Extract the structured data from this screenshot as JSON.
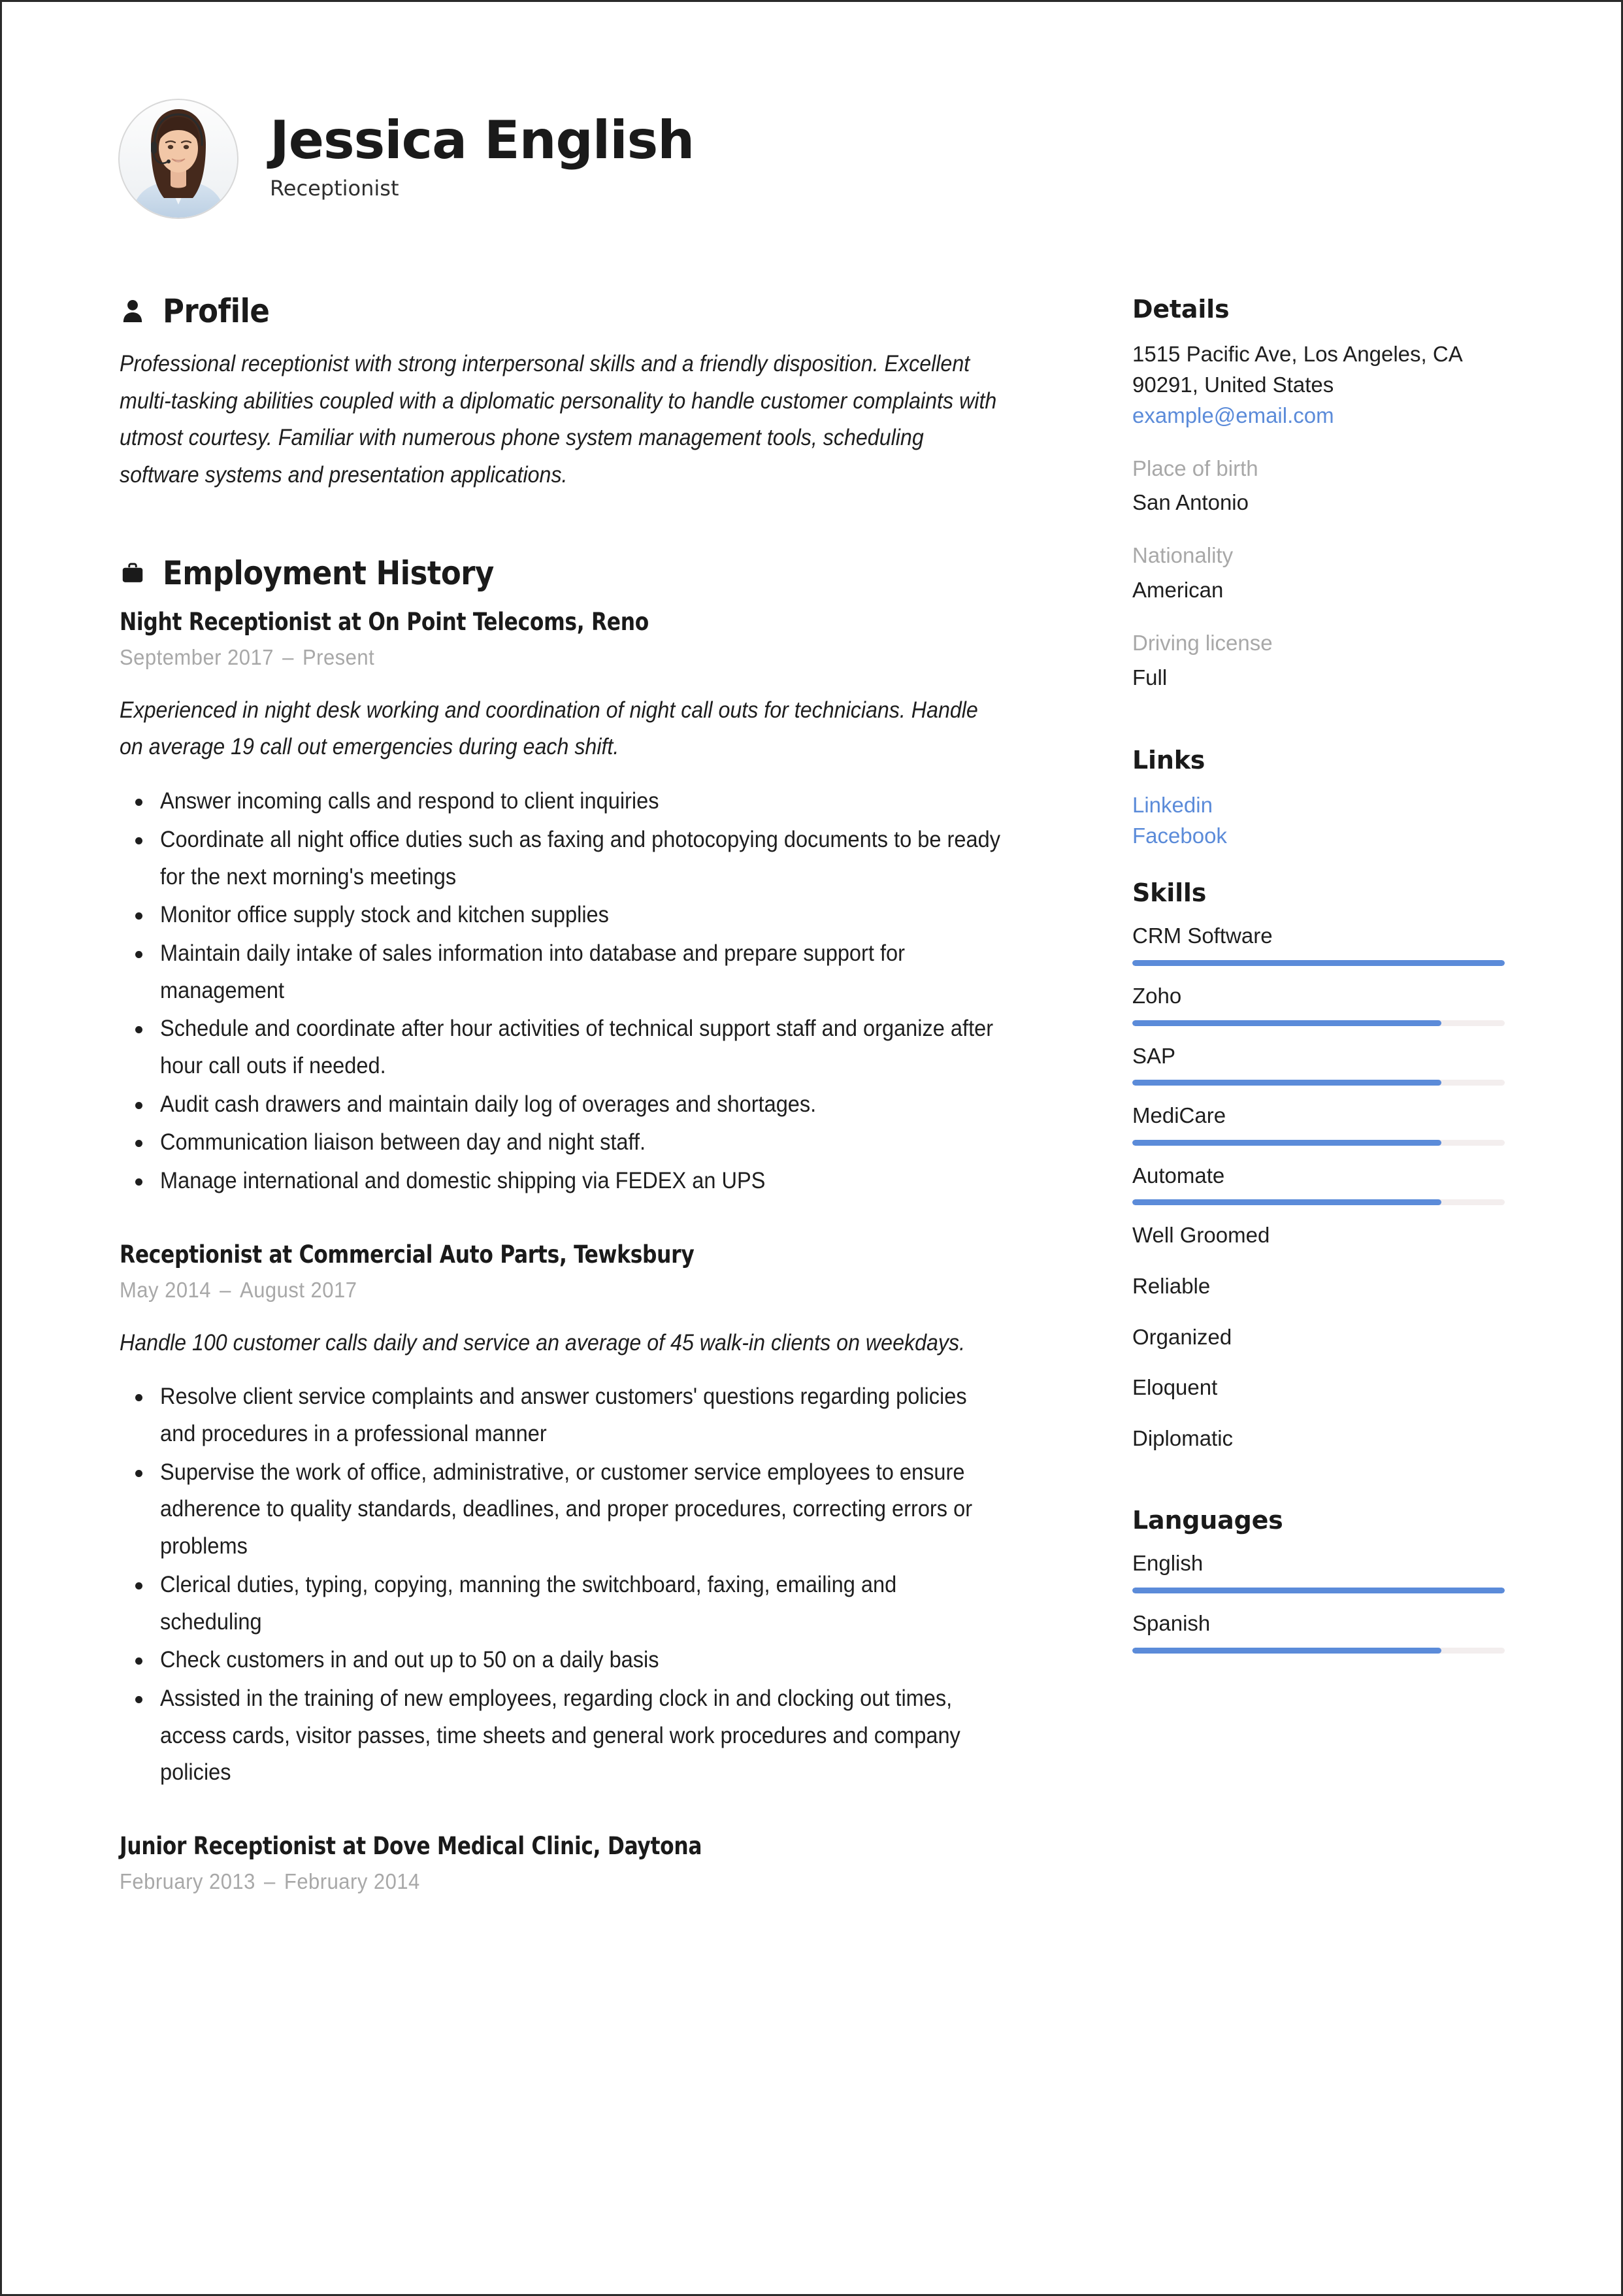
{
  "colors": {
    "accent": "#5b8bd9",
    "text": "#1e1e1e",
    "muted": "#a8a8a8",
    "bar_track": "#f3eeee",
    "heading": "#1a1a1a"
  },
  "header": {
    "full_name": "Jessica English",
    "job_title": "Receptionist",
    "avatar_icon": "person-photo"
  },
  "profile": {
    "icon": "person-icon",
    "title": "Profile",
    "text": "Professional receptionist with strong interpersonal skills and a friendly disposition. Excellent multi-tasking abilities coupled with a diplomatic personality to handle customer complaints with utmost courtesy. Familiar with numerous phone system management tools, scheduling software systems and presentation applications."
  },
  "employment": {
    "icon": "briefcase-icon",
    "title": "Employment History",
    "jobs": [
      {
        "heading": "Night Receptionist at On Point Telecoms, Reno",
        "date_start": "September 2017",
        "date_end": "Present",
        "summary": "Experienced in night desk working and coordination of night call outs for technicians. Handle on average 19 call out emergencies during each shift.",
        "bullets": [
          "Answer incoming calls and respond to client inquiries",
          "Coordinate all night office duties such as faxing and photocopying documents to be ready for the next morning's meetings",
          "Monitor office supply stock and kitchen supplies",
          "Maintain daily intake of sales information into database and prepare support for management",
          "Schedule and coordinate after hour activities of technical support staff and organize after hour call outs if needed.",
          "Audit cash drawers and maintain daily log of overages and shortages.",
          "Communication liaison between day and night staff.",
          "Manage international and domestic shipping via FEDEX an UPS"
        ]
      },
      {
        "heading": "Receptionist at Commercial Auto Parts, Tewksbury",
        "date_start": "May 2014",
        "date_end": "August 2017",
        "summary": "Handle 100 customer calls daily and service an average of 45 walk-in clients on weekdays.",
        "bullets": [
          "Resolve client service complaints and answer customers' questions regarding policies and procedures in a professional manner",
          "Supervise the work of office, administrative, or customer service employees to ensure adherence to quality standards, deadlines, and proper procedures, correcting errors or problems",
          "Clerical duties, typing, copying, manning the switchboard, faxing, emailing and scheduling",
          "Check customers in and out up to 50 on a daily basis",
          "Assisted in the training of new employees, regarding clock in and clocking out times, access cards, visitor passes, time sheets and general work procedures and company policies"
        ]
      },
      {
        "heading": "Junior Receptionist at Dove Medical Clinic, Daytona",
        "date_start": "February 2013",
        "date_end": "February 2014",
        "summary": "",
        "bullets": []
      }
    ],
    "date_separator": "–"
  },
  "details": {
    "title": "Details",
    "address_line_1": "1515 Pacific Ave, Los Angeles, CA",
    "address_line_2": "90291, United States",
    "email": "example@email.com",
    "fields": [
      {
        "label": "Place of birth",
        "value": "San Antonio"
      },
      {
        "label": "Nationality",
        "value": "American"
      },
      {
        "label": "Driving license",
        "value": "Full"
      }
    ]
  },
  "links": {
    "title": "Links",
    "items": [
      {
        "label": "Linkedin"
      },
      {
        "label": "Facebook"
      }
    ]
  },
  "skills": {
    "title": "Skills",
    "items": [
      {
        "label": "CRM Software",
        "level": 100,
        "has_bar": true
      },
      {
        "label": "Zoho",
        "level": 83,
        "has_bar": true
      },
      {
        "label": "SAP",
        "level": 83,
        "has_bar": true
      },
      {
        "label": "MediCare",
        "level": 83,
        "has_bar": true
      },
      {
        "label": "Automate",
        "level": 83,
        "has_bar": true
      },
      {
        "label": "Well Groomed",
        "level": 0,
        "has_bar": false
      },
      {
        "label": "Reliable",
        "level": 0,
        "has_bar": false
      },
      {
        "label": "Organized",
        "level": 0,
        "has_bar": false
      },
      {
        "label": "Eloquent",
        "level": 0,
        "has_bar": false
      },
      {
        "label": "Diplomatic",
        "level": 0,
        "has_bar": false
      }
    ]
  },
  "languages": {
    "title": "Languages",
    "items": [
      {
        "label": "English",
        "level": 100,
        "has_bar": true
      },
      {
        "label": "Spanish",
        "level": 83,
        "has_bar": true
      }
    ]
  }
}
